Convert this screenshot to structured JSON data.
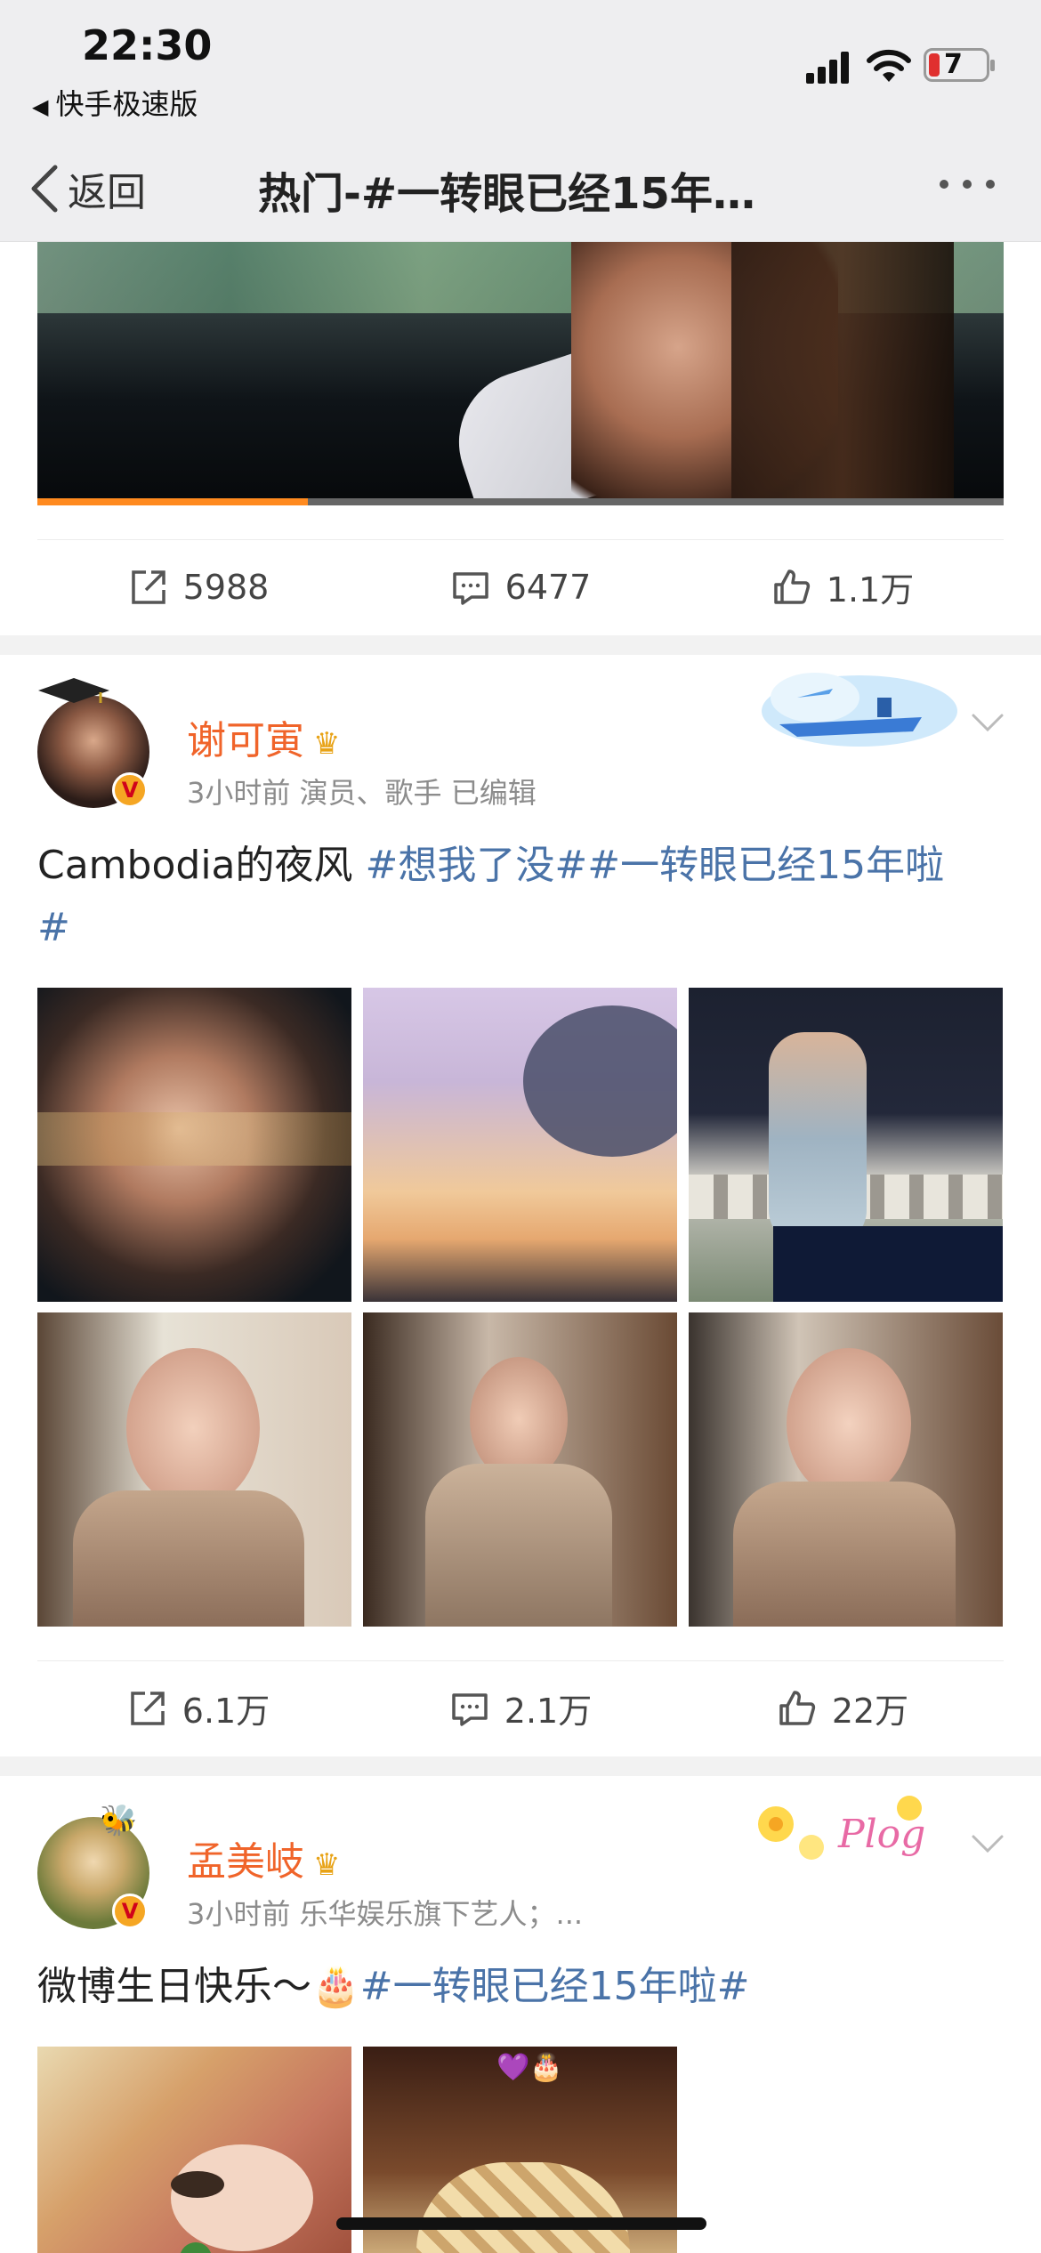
{
  "status_bar": {
    "time": "22:30",
    "back_app": "快手极速版",
    "battery_level": "7"
  },
  "nav": {
    "back_label": "返回",
    "title": "热门-#一转眼已经15年…"
  },
  "video_post": {
    "progress_percent": 28,
    "shares": "5988",
    "comments": "6477",
    "likes": "1.1万"
  },
  "posts": [
    {
      "user_name": "谢可寅",
      "time": "3小时前",
      "meta": "演员、歌手  已编辑",
      "text_plain": "Cambodia的夜风 ",
      "text_tag1": "#想我了没#",
      "text_tag2": "#一转眼已经15年啦",
      "text_tag3": "#",
      "photos": [
        "portrait-night",
        "sunset-sky",
        "balcony-dress",
        "dress-sitting",
        "dress-hands-hips",
        "dress-arm-raised"
      ],
      "shares": "6.1万",
      "comments": "2.1万",
      "likes": "22万"
    },
    {
      "user_name": "孟美岐",
      "time": "3小时前",
      "meta": "乐华娱乐旗下艺人；...",
      "text_plain": "微博生日快乐～",
      "text_tag": "#一转眼已经15年啦#",
      "emoji": "🎂",
      "badge_text": "Plog",
      "photos": [
        "face-closeup",
        "braided-hair"
      ]
    }
  ],
  "colors": {
    "username": "#f0642a",
    "hashtag": "#4a73a8",
    "progress": "#ff8a1f"
  }
}
